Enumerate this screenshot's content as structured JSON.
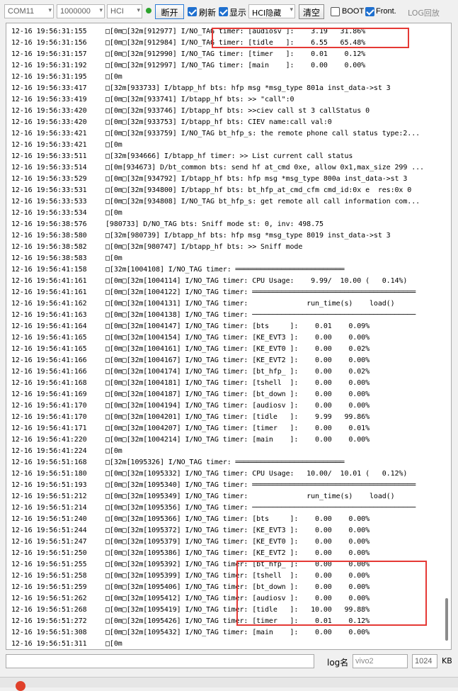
{
  "toolbar": {
    "port": "COM11",
    "baud": "1000000",
    "mode": "HCI",
    "disconnect_label": "断开",
    "refresh_label": "刷新",
    "display_label": "显示",
    "hci_hide_label": "HCI隐藏",
    "clear_label": "清空",
    "boot_label": "BOOT",
    "front_label": "Front.",
    "log_playback_label": "LOG回放"
  },
  "log": {
    "lines": [
      {
        "ts": "12-16 19:56:31:155",
        "text": "□[0m□[32m[912977] I/NO_TAG timer: [audiosv ]:    3.19   31.86%"
      },
      {
        "ts": "12-16 19:56:31:156",
        "text": "□[0m□[32m[912984] I/NO_TAG timer: [tidle   ]:    6.55   65.48%"
      },
      {
        "ts": "12-16 19:56:31:157",
        "text": "□[0m□[32m[912990] I/NO_TAG timer: [timer   ]:    0.01    0.12%"
      },
      {
        "ts": "12-16 19:56:31:192",
        "text": "□[0m□[32m[912997] I/NO_TAG timer: [main    ]:    0.00    0.00%"
      },
      {
        "ts": "12-16 19:56:31:195",
        "text": "□[0m"
      },
      {
        "ts": "12-16 19:56:33:417",
        "text": "□[32m[933733] I/btapp_hf bts: hfp msg *msg_type 801a inst_data->st 3"
      },
      {
        "ts": "12-16 19:56:33:419",
        "text": "□[0m□[32m[933741] I/btapp_hf bts: >> \"call\":0"
      },
      {
        "ts": "12-16 19:56:33:420",
        "text": "□[0m□[32m[933746] I/btapp_hf bts: >>ciev call st 3 callStatus 0"
      },
      {
        "ts": "12-16 19:56:33:420",
        "text": "□[0m□[32m[933753] I/btapp_hf bts: CIEV name:call val:0"
      },
      {
        "ts": "12-16 19:56:33:421",
        "text": "□[0m□[32m[933759] I/NO_TAG bt_hfp_s: the remote phone call status type:2..."
      },
      {
        "ts": "12-16 19:56:33:421",
        "text": "□[0m"
      },
      {
        "ts": "12-16 19:56:33:511",
        "text": "□[32m[934666] I/btapp_hf timer: >> List current call status"
      },
      {
        "ts": "12-16 19:56:33:514",
        "text": "□[0m[934673] D/bt_common bts: send hf at_cmd 0xe, allow 0x1,max_size 299 ..."
      },
      {
        "ts": "12-16 19:56:33:529",
        "text": "□[0m□[32m[934792] I/btapp_hf bts: hfp msg *msg_type 800a inst_data->st 3"
      },
      {
        "ts": "12-16 19:56:33:531",
        "text": "□[0m□[32m[934800] I/btapp_hf bts: bt_hfp_at_cmd_cfm cmd_id:0x e  res:0x 0"
      },
      {
        "ts": "12-16 19:56:33:533",
        "text": "□[0m□[32m[934808] I/NO_TAG bt_hfp_s: get remote all call information com..."
      },
      {
        "ts": "12-16 19:56:33:534",
        "text": "□[0m"
      },
      {
        "ts": "12-16 19:56:38:576",
        "text": "[980733] D/NO_TAG bts: Sniff mode st: 0, inv: 498.75"
      },
      {
        "ts": "12-16 19:56:38:580",
        "text": "□[32m[980739] I/btapp_hf bts: hfp msg *msg_type 8019 inst_data->st 3"
      },
      {
        "ts": "12-16 19:56:38:582",
        "text": "□[0m□[32m[980747] I/btapp_hf bts: >> Sniff mode"
      },
      {
        "ts": "12-16 19:56:38:583",
        "text": "□[0m"
      },
      {
        "ts": "12-16 19:56:41:158",
        "text": "□[32m[1004108] I/NO_TAG timer: ══════════════════════════"
      },
      {
        "ts": "12-16 19:56:41:161",
        "text": "□[0m□[32m[1004114] I/NO_TAG timer: CPU Usage:    9.99/  10.00 (   0.14%)"
      },
      {
        "ts": "12-16 19:56:41:161",
        "text": "□[0m□[32m[1004122] I/NO_TAG timer: ═══════════════════════════════════════"
      },
      {
        "ts": "12-16 19:56:41:162",
        "text": "□[0m□[32m[1004131] I/NO_TAG timer:              run_time(s)    load()"
      },
      {
        "ts": "12-16 19:56:41:163",
        "text": "□[0m□[32m[1004138] I/NO_TAG timer: ───────────────────────────────────────"
      },
      {
        "ts": "12-16 19:56:41:164",
        "text": "□[0m□[32m[1004147] I/NO_TAG timer: [bts     ]:    0.01    0.09%"
      },
      {
        "ts": "12-16 19:56:41:165",
        "text": "□[0m□[32m[1004154] I/NO_TAG timer: [KE_EVT3 ]:    0.00    0.00%"
      },
      {
        "ts": "12-16 19:56:41:165",
        "text": "□[0m□[32m[1004161] I/NO_TAG timer: [KE_EVT0 ]:    0.00    0.02%"
      },
      {
        "ts": "12-16 19:56:41:166",
        "text": "□[0m□[32m[1004167] I/NO_TAG timer: [KE_EVT2 ]:    0.00    0.00%"
      },
      {
        "ts": "12-16 19:56:41:166",
        "text": "□[0m□[32m[1004174] I/NO_TAG timer: [bt_hfp_ ]:    0.00    0.02%"
      },
      {
        "ts": "12-16 19:56:41:168",
        "text": "□[0m□[32m[1004181] I/NO_TAG timer: [tshell  ]:    0.00    0.00%"
      },
      {
        "ts": "12-16 19:56:41:169",
        "text": "□[0m□[32m[1004187] I/NO_TAG timer: [bt_down ]:    0.00    0.00%"
      },
      {
        "ts": "12-16 19:56:41:170",
        "text": "□[0m□[32m[1004194] I/NO_TAG timer: [audiosv ]:    0.00    0.00%"
      },
      {
        "ts": "12-16 19:56:41:170",
        "text": "□[0m□[32m[1004201] I/NO_TAG timer: [tidle   ]:    9.99   99.86%"
      },
      {
        "ts": "12-16 19:56:41:171",
        "text": "□[0m□[32m[1004207] I/NO_TAG timer: [timer   ]:    0.00    0.01%"
      },
      {
        "ts": "12-16 19:56:41:220",
        "text": "□[0m□[32m[1004214] I/NO_TAG timer: [main    ]:    0.00    0.00%"
      },
      {
        "ts": "12-16 19:56:41:224",
        "text": "□[0m"
      },
      {
        "ts": "12-16 19:56:51:168",
        "text": "□[32m[1095326] I/NO_TAG timer: ══════════════════════════"
      },
      {
        "ts": "12-16 19:56:51:180",
        "text": "□[0m□[32m[1095332] I/NO_TAG timer: CPU Usage:   10.00/  10.01 (   0.12%)"
      },
      {
        "ts": "12-16 19:56:51:193",
        "text": "□[0m□[32m[1095340] I/NO_TAG timer: ═══════════════════════════════════════"
      },
      {
        "ts": "12-16 19:56:51:212",
        "text": "□[0m□[32m[1095349] I/NO_TAG timer:              run_time(s)    load()"
      },
      {
        "ts": "12-16 19:56:51:214",
        "text": "□[0m□[32m[1095356] I/NO_TAG timer: ───────────────────────────────────────"
      },
      {
        "ts": "12-16 19:56:51:240",
        "text": "□[0m□[32m[1095366] I/NO_TAG timer: [bts     ]:    0.00    0.00%"
      },
      {
        "ts": "12-16 19:56:51:244",
        "text": "□[0m□[32m[1095372] I/NO_TAG timer: [KE_EVT3 ]:    0.00    0.00%"
      },
      {
        "ts": "12-16 19:56:51:247",
        "text": "□[0m□[32m[1095379] I/NO_TAG timer: [KE_EVT0 ]:    0.00    0.00%"
      },
      {
        "ts": "12-16 19:56:51:250",
        "text": "□[0m□[32m[1095386] I/NO_TAG timer: [KE_EVT2 ]:    0.00    0.00%"
      },
      {
        "ts": "12-16 19:56:51:255",
        "text": "□[0m□[32m[1095392] I/NO_TAG timer: [bt_hfp_ ]:    0.00    0.00%"
      },
      {
        "ts": "12-16 19:56:51:258",
        "text": "□[0m□[32m[1095399] I/NO_TAG timer: [tshell  ]:    0.00    0.00%"
      },
      {
        "ts": "12-16 19:56:51:259",
        "text": "□[0m□[32m[1095406] I/NO_TAG timer: [bt_down ]:    0.00    0.00%"
      },
      {
        "ts": "12-16 19:56:51:262",
        "text": "□[0m□[32m[1095412] I/NO_TAG timer: [audiosv ]:    0.00    0.00%"
      },
      {
        "ts": "12-16 19:56:51:268",
        "text": "□[0m□[32m[1095419] I/NO_TAG timer: [tidle   ]:   10.00   99.88%"
      },
      {
        "ts": "12-16 19:56:51:272",
        "text": "□[0m□[32m[1095426] I/NO_TAG timer: [timer   ]:    0.01    0.12%"
      },
      {
        "ts": "12-16 19:56:51:308",
        "text": "□[0m□[32m[1095432] I/NO_TAG timer: [main    ]:    0.00    0.00%"
      },
      {
        "ts": "12-16 19:56:51:311",
        "text": "□[0m"
      }
    ]
  },
  "bottom": {
    "command_value": "",
    "log_name_label": "log名",
    "log_name_value": "vivo2",
    "size_value": "1024",
    "size_unit": "KB"
  },
  "colors": {
    "highlight": "#e53935",
    "checkbox_accent": "#1f70cf",
    "status_dot": "#2ca32c"
  }
}
